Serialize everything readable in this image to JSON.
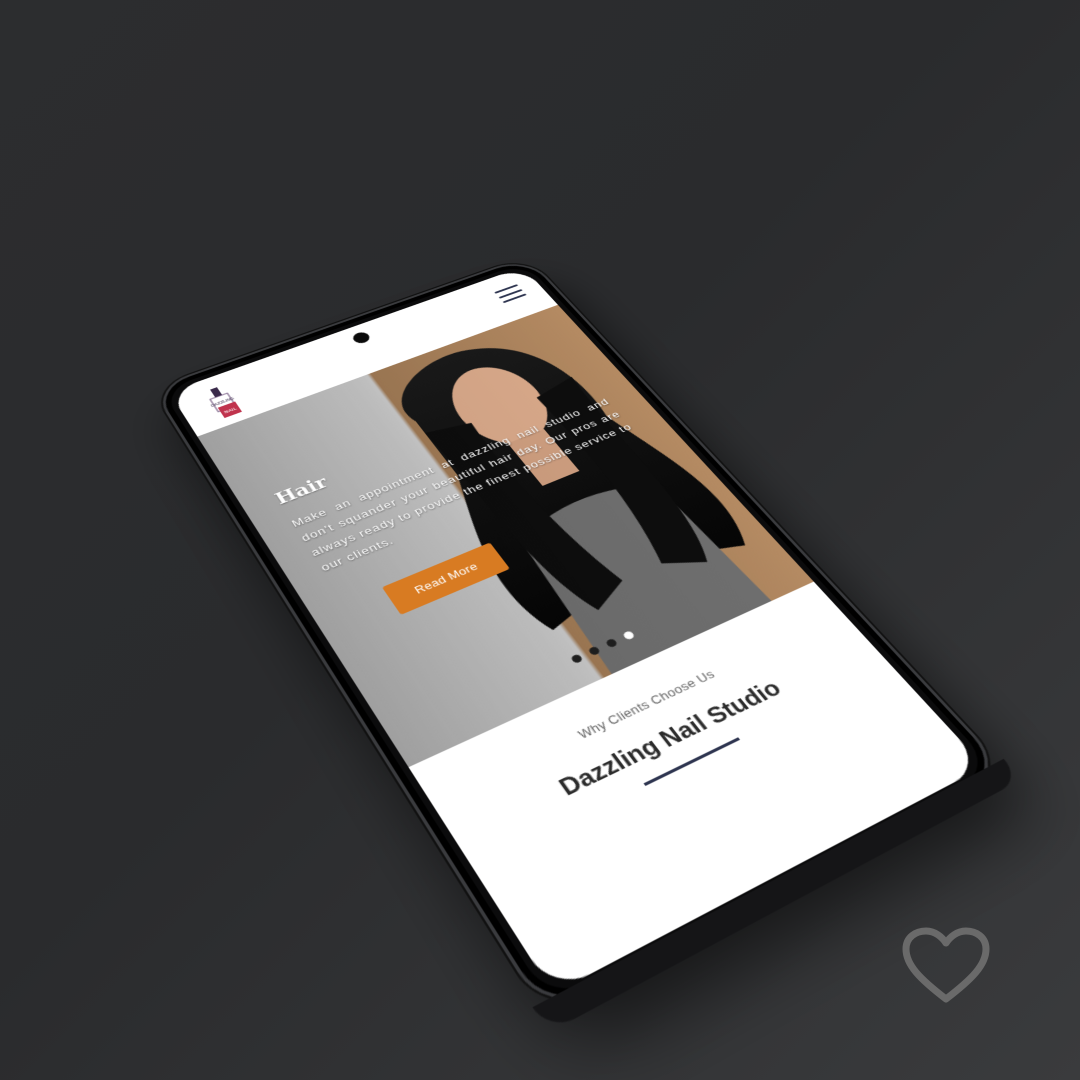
{
  "header": {
    "logo_alt": "Dazzling Nail Studio logo",
    "menu_icon": "hamburger-menu-icon"
  },
  "hero": {
    "title": "Hair",
    "description": "Make an appointment at dazzling nail studio and don't squander your beautiful hair day. Our pros are always ready to provide the finest possible service to our clients.",
    "button_label": "Read More",
    "slide_count": 4,
    "active_slide": 4
  },
  "why": {
    "subtitle": "Why Clients Choose Us",
    "title": "Dazzling Nail Studio"
  },
  "overlay": {
    "favorite_icon": "heart-icon"
  },
  "colors": {
    "accent": "#d87b22",
    "navy": "#2e3550",
    "background": "#2c2d2f"
  }
}
